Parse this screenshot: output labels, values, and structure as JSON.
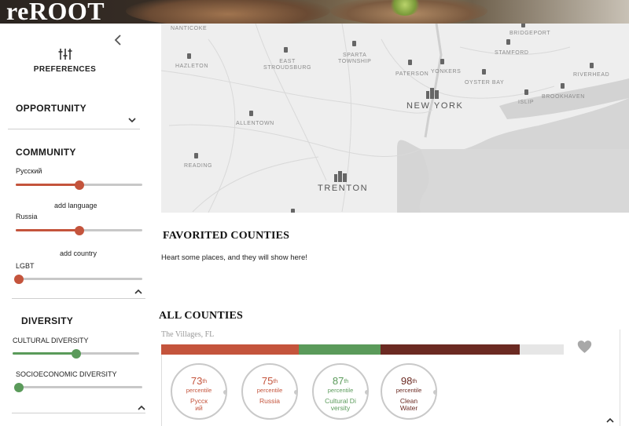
{
  "app": {
    "title": "reROOT"
  },
  "sidebar": {
    "preferences_label": "PREFERENCES",
    "opportunity": {
      "title": "OPPORTUNITY"
    },
    "community": {
      "title": "COMMUNITY",
      "language": {
        "label": "Русский",
        "level": 0.5
      },
      "add_language": "add language",
      "country": {
        "label": "Russia",
        "level": 0.5
      },
      "add_country": "add country",
      "lgbt": {
        "label": "LGBT",
        "level": 0.0
      }
    },
    "diversity": {
      "title": "DIVERSITY",
      "cultural": {
        "label": "CULTURAL DIVERSITY",
        "level": 0.5
      },
      "socioeconomic": {
        "label": "SOCIOECONOMIC DIVERSITY",
        "level": 0.0
      }
    }
  },
  "map": {
    "places": {
      "nanticoke": "NANTICOKE",
      "hazleton": "HAZLETON",
      "east_stroudsburg": "EAST\nSTROUDSBURG",
      "sparta": "SPARTA\nTOWNSHIP",
      "paterson": "PATERSON",
      "yonkers": "YONKERS",
      "stamford": "STAMFORD",
      "bridgeport": "BRIDGEPORT",
      "oyster_bay": "OYSTER BAY",
      "riverhead": "RIVERHEAD",
      "new_york": "NEW YORK",
      "islip": "ISLIP",
      "brookhaven": "BROOKHAVEN",
      "allentown": "ALLENTOWN",
      "reading": "READING",
      "trenton": "TRENTON"
    }
  },
  "favorites": {
    "title": "FAVORITED COUNTIES",
    "empty_message": "Heart some places, and they will show here!"
  },
  "all_counties": {
    "title": "ALL COUNTIES",
    "county": {
      "name": "The Villages, FL",
      "metrics": [
        {
          "value": "73",
          "suffix": "th",
          "percentile_label": "percentile",
          "name": "Русский",
          "color": "#c4543c"
        },
        {
          "value": "75",
          "suffix": "th",
          "percentile_label": "percentile",
          "name": "Russia",
          "color": "#c4543c"
        },
        {
          "value": "87",
          "suffix": "th",
          "percentile_label": "percentile",
          "name": "Cultural Diversity",
          "color": "#5a9a5a"
        },
        {
          "value": "98",
          "suffix": "th",
          "percentile_label": "percentile",
          "name": "Clean Water",
          "color": "#6b2a22"
        }
      ]
    }
  },
  "colors": {
    "accent_red": "#c4543c",
    "accent_green": "#5a9a5a",
    "accent_brown": "#6b2a22",
    "track_gray": "#c8c8c8"
  },
  "icons": {
    "collapse": "chevron-left-icon",
    "preferences": "sliders-icon",
    "expand": "chevron-down-icon",
    "collapse_section": "chevron-up-icon",
    "favorite": "heart-icon"
  }
}
